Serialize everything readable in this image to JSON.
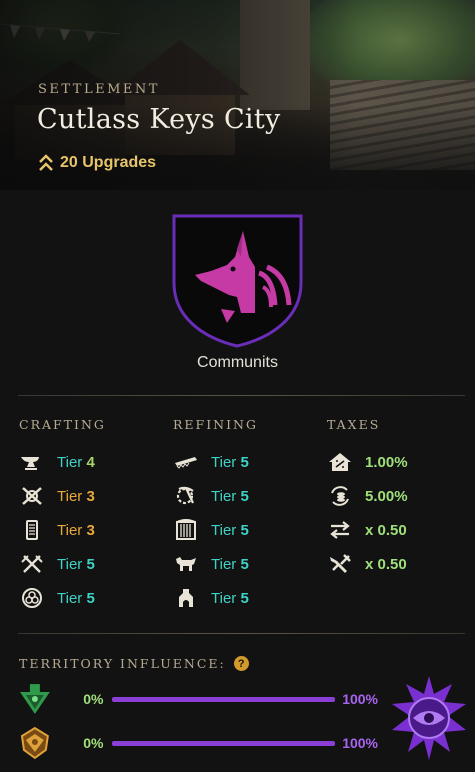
{
  "header": {
    "type_label": "SETTLEMENT",
    "name": "Cutlass Keys City",
    "upgrades": "20 Upgrades"
  },
  "company": {
    "name": "Communits"
  },
  "crafting": {
    "title": "CRAFTING",
    "items": [
      {
        "icon": "anvil-icon",
        "tier_word": "Tier",
        "tier": "4"
      },
      {
        "icon": "crossed-tools-icon",
        "tier_word": "Tier",
        "tier": "3"
      },
      {
        "icon": "scroll-icon",
        "tier_word": "Tier",
        "tier": "3"
      },
      {
        "icon": "crossed-swords-icon",
        "tier_word": "Tier",
        "tier": "5"
      },
      {
        "icon": "arcane-circle-icon",
        "tier_word": "Tier",
        "tier": "5"
      }
    ]
  },
  "refining": {
    "title": "REFINING",
    "items": [
      {
        "icon": "saw-icon",
        "tier_word": "Tier",
        "tier": "5"
      },
      {
        "icon": "pickaxe-gear-icon",
        "tier_word": "Tier",
        "tier": "5"
      },
      {
        "icon": "loom-icon",
        "tier_word": "Tier",
        "tier": "5"
      },
      {
        "icon": "tannery-icon",
        "tier_word": "Tier",
        "tier": "5"
      },
      {
        "icon": "furnace-icon",
        "tier_word": "Tier",
        "tier": "5"
      }
    ]
  },
  "taxes": {
    "title": "TAXES",
    "items": [
      {
        "icon": "house-tax-icon",
        "value": "1.00%"
      },
      {
        "icon": "coin-cycle-icon",
        "value": "5.00%"
      },
      {
        "icon": "trade-arrows-icon",
        "value": "x 0.50"
      },
      {
        "icon": "crafting-fee-icon",
        "value": "x 0.50"
      }
    ]
  },
  "territory": {
    "title": "TERRITORY INFLUENCE:",
    "help": "?",
    "rows": [
      {
        "faction_icon": "syndicate-icon",
        "influence": "0%",
        "owner_influence": "100%",
        "influence_fraction": 0.0
      },
      {
        "faction_icon": "marauders-icon",
        "influence": "0%",
        "owner_influence": "100%",
        "influence_fraction": 0.0
      }
    ],
    "owner_icon": "covenant-eye-emblem-icon"
  },
  "colors": {
    "accent_gold": "#e8c56a",
    "tier_teal": "#3fd3c6",
    "tier_orange": "#e8a93a",
    "tier_green": "#a7d36b",
    "tax_green": "#9fe07a",
    "influence_purple": "#8a3fd6"
  }
}
